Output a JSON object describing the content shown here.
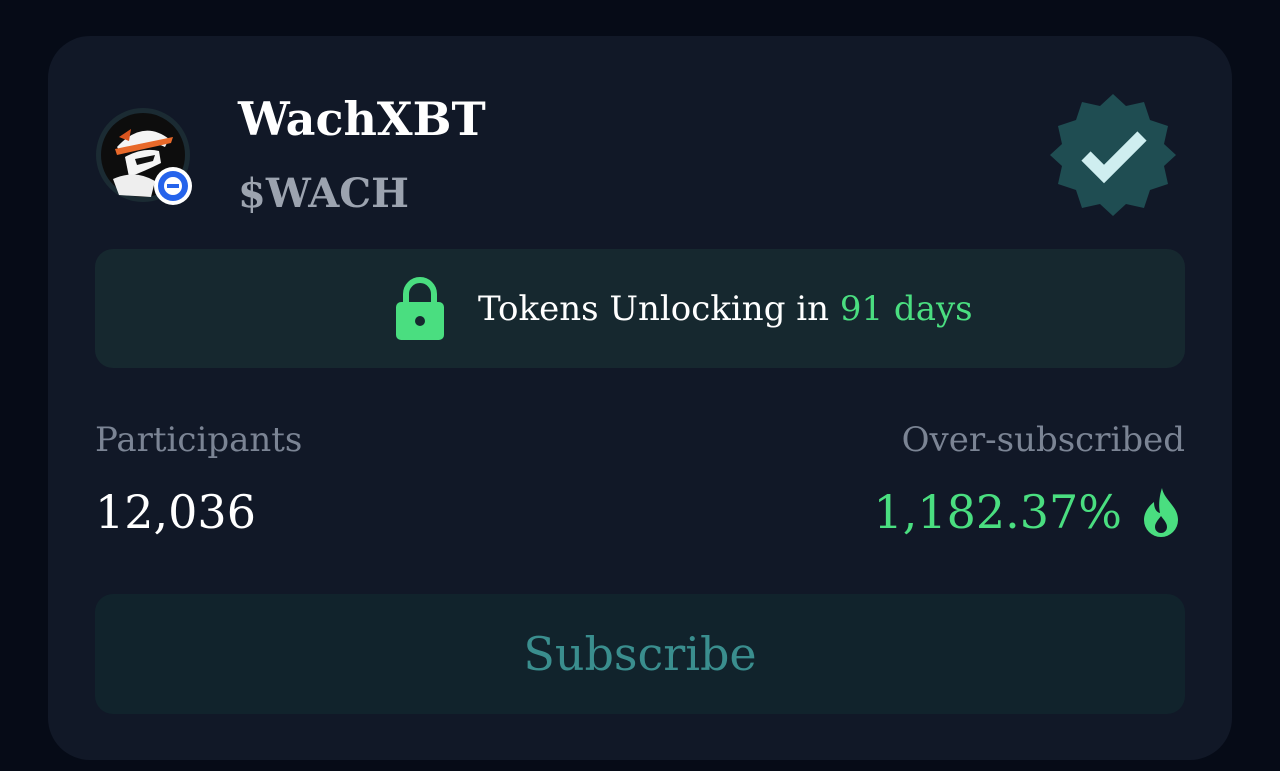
{
  "project": {
    "name": "WachXBT",
    "ticker": "$WACH",
    "avatar_icon": "hooded-spy-avatar-icon",
    "chain_badge_icon": "minus-circle-icon",
    "verified_icon": "verified-badge-icon"
  },
  "unlock": {
    "prefix": "Tokens Unlocking in",
    "days": "91 days",
    "icon": "lock-icon"
  },
  "stats": {
    "participants_label": "Participants",
    "participants_value": "12,036",
    "oversubscribed_label": "Over-subscribed",
    "oversubscribed_value": "1,182.37%",
    "oversubscribed_icon": "flame-icon"
  },
  "actions": {
    "subscribe_label": "Subscribe"
  },
  "colors": {
    "background": "#060b17",
    "card": "#111827",
    "accent_green": "#4ade80",
    "muted_text": "#7b8494",
    "subscribe_text": "#3a8e8e",
    "verified_fill": "#1f4d52"
  }
}
